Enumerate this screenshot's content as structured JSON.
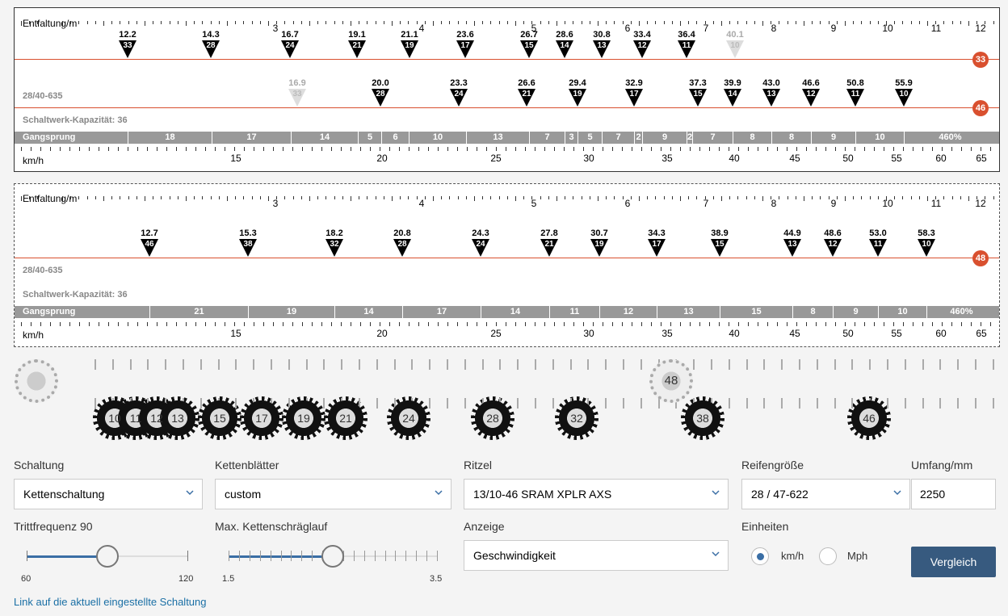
{
  "panel1": {
    "entfaltung_label": "Entfaltung/m",
    "entfaltung_ticks": [
      "3",
      "4",
      "5",
      "6",
      "7",
      "8",
      "9",
      "10",
      "11",
      "12"
    ],
    "chainring_33": {
      "badge": "33",
      "gears": [
        {
          "v": "12.2",
          "t": "33",
          "faded": false
        },
        {
          "v": "14.3",
          "t": "28",
          "faded": false
        },
        {
          "v": "16.7",
          "t": "24",
          "faded": false
        },
        {
          "v": "19.1",
          "t": "21",
          "faded": false
        },
        {
          "v": "21.1",
          "t": "19",
          "faded": false
        },
        {
          "v": "23.6",
          "t": "17",
          "faded": false
        },
        {
          "v": "26.7",
          "t": "15",
          "faded": false
        },
        {
          "v": "28.6",
          "t": "14",
          "faded": false
        },
        {
          "v": "30.8",
          "t": "13",
          "faded": false
        },
        {
          "v": "33.4",
          "t": "12",
          "faded": false
        },
        {
          "v": "36.4",
          "t": "11",
          "faded": false
        },
        {
          "v": "40.1",
          "t": "10",
          "faded": true
        }
      ]
    },
    "chainring_46": {
      "badge": "46",
      "gears": [
        {
          "v": "16.9",
          "t": "33",
          "faded": true
        },
        {
          "v": "20.0",
          "t": "28",
          "faded": false
        },
        {
          "v": "23.3",
          "t": "24",
          "faded": false
        },
        {
          "v": "26.6",
          "t": "21",
          "faded": false
        },
        {
          "v": "29.4",
          "t": "19",
          "faded": false
        },
        {
          "v": "32.9",
          "t": "17",
          "faded": false
        },
        {
          "v": "37.3",
          "t": "15",
          "faded": false
        },
        {
          "v": "39.9",
          "t": "14",
          "faded": false
        },
        {
          "v": "43.0",
          "t": "13",
          "faded": false
        },
        {
          "v": "46.6",
          "t": "12",
          "faded": false
        },
        {
          "v": "50.8",
          "t": "11",
          "faded": false
        },
        {
          "v": "55.9",
          "t": "10",
          "faded": false
        }
      ]
    },
    "tire_label": "28/40-635",
    "capacity_label": "Schaltwerk-Kapazität: 36",
    "gangsprung_label": "Gangsprung",
    "gangsprung": [
      "18",
      "17",
      "14",
      "5",
      "6",
      "10",
      "13",
      "7",
      "3",
      "5",
      "7",
      "2",
      "9",
      "2",
      "7",
      "8",
      "8",
      "9",
      "10",
      "460%"
    ],
    "kmh_label": "km/h",
    "kmh_ticks": [
      "15",
      "20",
      "25",
      "30",
      "35",
      "40",
      "45",
      "50",
      "55",
      "60",
      "65"
    ]
  },
  "panel2": {
    "entfaltung_label": "Entfaltung/m",
    "entfaltung_ticks": [
      "3",
      "4",
      "5",
      "6",
      "7",
      "8",
      "9",
      "10",
      "11",
      "12"
    ],
    "chainring_48": {
      "badge": "48",
      "gears": [
        {
          "v": "12.7",
          "t": "46",
          "faded": false
        },
        {
          "v": "15.3",
          "t": "38",
          "faded": false
        },
        {
          "v": "18.2",
          "t": "32",
          "faded": false
        },
        {
          "v": "20.8",
          "t": "28",
          "faded": false
        },
        {
          "v": "24.3",
          "t": "24",
          "faded": false
        },
        {
          "v": "27.8",
          "t": "21",
          "faded": false
        },
        {
          "v": "30.7",
          "t": "19",
          "faded": false
        },
        {
          "v": "34.3",
          "t": "17",
          "faded": false
        },
        {
          "v": "38.9",
          "t": "15",
          "faded": false
        },
        {
          "v": "44.9",
          "t": "13",
          "faded": false
        },
        {
          "v": "48.6",
          "t": "12",
          "faded": false
        },
        {
          "v": "53.0",
          "t": "11",
          "faded": false
        },
        {
          "v": "58.3",
          "t": "10",
          "faded": false
        }
      ]
    },
    "tire_label": "28/40-635",
    "capacity_label": "Schaltwerk-Kapazität: 36",
    "gangsprung_label": "Gangsprung",
    "gangsprung": [
      "21",
      "19",
      "14",
      "17",
      "14",
      "11",
      "12",
      "13",
      "15",
      "8",
      "9",
      "10",
      "460%"
    ],
    "kmh_label": "km/h",
    "kmh_ticks": [
      "15",
      "20",
      "25",
      "30",
      "35",
      "40",
      "45",
      "50",
      "55",
      "60",
      "65"
    ]
  },
  "visual": {
    "chainring": "48",
    "cogs": [
      "10",
      "11",
      "12",
      "13",
      "15",
      "17",
      "19",
      "21",
      "24",
      "28",
      "32",
      "38",
      "46"
    ]
  },
  "form": {
    "schaltung": {
      "label": "Schaltung",
      "value": "Kettenschaltung"
    },
    "kettenblaetter": {
      "label": "Kettenblätter",
      "value": "custom"
    },
    "ritzel": {
      "label": "Ritzel",
      "value": "13/10-46 SRAM XPLR AXS"
    },
    "reifen": {
      "label": "Reifengröße",
      "value": "28 / 47-622"
    },
    "umfang": {
      "label": "Umfang/mm",
      "value": "2250"
    },
    "trittfrequenz": {
      "label": "Trittfrequenz 90",
      "min": "60",
      "max": "120",
      "value": 90
    },
    "schraeglauf": {
      "label": "Max. Kettenschräglauf",
      "min": "1.5",
      "max": "3.5",
      "value": 2.5
    },
    "anzeige": {
      "label": "Anzeige",
      "value": "Geschwindigkeit"
    },
    "einheiten": {
      "label": "Einheiten",
      "opt1": "km/h",
      "opt2": "Mph",
      "selected": "km/h"
    },
    "vergleich": "Vergleich",
    "link": "Link auf die aktuell eingestellte Schaltung"
  },
  "colors": {
    "accent": "#d9502f",
    "button": "#375a7f",
    "link": "#1a6fa5"
  }
}
